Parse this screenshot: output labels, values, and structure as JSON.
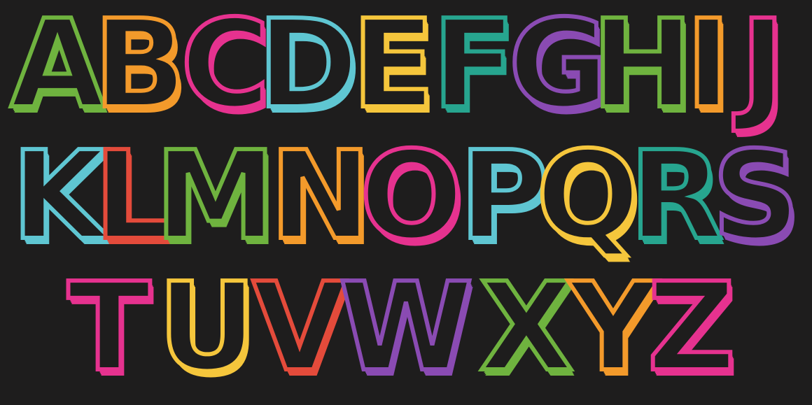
{
  "canvas": {
    "background": "#1e1d1d"
  },
  "rows": [
    {
      "letters": [
        {
          "char": "A",
          "color": "#6fb33f"
        },
        {
          "char": "B",
          "color": "#f39a2b"
        },
        {
          "char": "C",
          "color": "#e6328f"
        },
        {
          "char": "D",
          "color": "#5fc6d2"
        },
        {
          "char": "E",
          "color": "#f5c63c"
        },
        {
          "char": "F",
          "color": "#27a58f"
        },
        {
          "char": "G",
          "color": "#8a4bb3"
        },
        {
          "char": "H",
          "color": "#6fb33f"
        },
        {
          "char": "I",
          "color": "#f39a2b"
        },
        {
          "char": "J",
          "color": "#e6328f"
        }
      ]
    },
    {
      "letters": [
        {
          "char": "K",
          "color": "#5fc6d2"
        },
        {
          "char": "L",
          "color": "#e44b3b"
        },
        {
          "char": "M",
          "color": "#6fb33f"
        },
        {
          "char": "N",
          "color": "#f39a2b"
        },
        {
          "char": "O",
          "color": "#e6328f"
        },
        {
          "char": "P",
          "color": "#5fc6d2"
        },
        {
          "char": "Q",
          "color": "#f5c63c"
        },
        {
          "char": "R",
          "color": "#27a58f"
        },
        {
          "char": "S",
          "color": "#8a4bb3"
        }
      ]
    },
    {
      "letters": [
        {
          "char": "T",
          "color": "#e6328f"
        },
        {
          "char": "U",
          "color": "#f5c63c"
        },
        {
          "char": "V",
          "color": "#e44b3b"
        },
        {
          "char": "W",
          "color": "#8a4bb3"
        },
        {
          "char": "X",
          "color": "#6fb33f"
        },
        {
          "char": "Y",
          "color": "#f39a2b"
        },
        {
          "char": "Z",
          "color": "#e6328f"
        }
      ]
    }
  ]
}
